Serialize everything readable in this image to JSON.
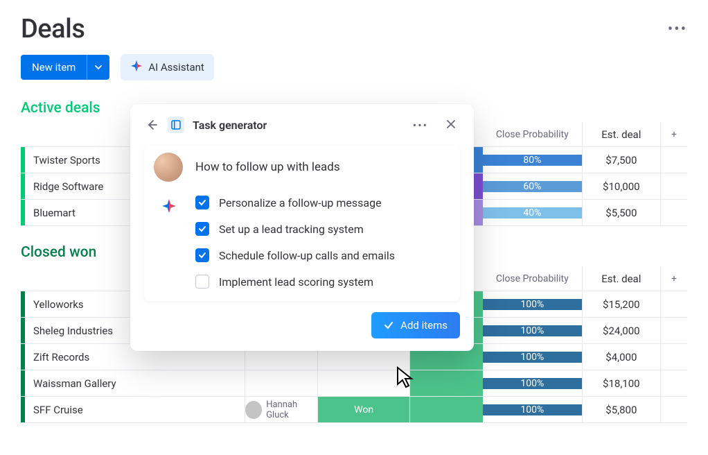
{
  "page": {
    "title": "Deals"
  },
  "toolbar": {
    "new_item": "New item",
    "ai_assistant": "AI Assistant"
  },
  "groups": {
    "active": {
      "title": "Active deals",
      "headers": {
        "prob": "Close Probability",
        "deal": "Est. deal"
      },
      "rows": [
        {
          "name": "Twister Sports",
          "accent": "#3b82d5",
          "prob_bg": "#3b82d5",
          "prob": "80%",
          "deal": "$7,500"
        },
        {
          "name": "Ridge Software",
          "accent": "#7b4ed0",
          "prob_bg": "#5b9cd8",
          "prob": "60%",
          "deal": "$10,000"
        },
        {
          "name": "Bluemart",
          "accent": "#a58ce0",
          "prob_bg": "#7fc0ea",
          "prob": "40%",
          "deal": "$5,500"
        }
      ]
    },
    "closed": {
      "title": "Closed won",
      "headers": {
        "prob": "Close Probability",
        "deal": "Est. deal"
      },
      "rows": [
        {
          "name": "Yelloworks",
          "accent": "#4cc38a",
          "prob_bg": "#2f6f9e",
          "prob": "100%",
          "deal": "$15,200"
        },
        {
          "name": "Sheleg Industries",
          "accent": "#4cc38a",
          "prob_bg": "#2f6f9e",
          "prob": "100%",
          "deal": "$24,000"
        },
        {
          "name": "Zift Records",
          "accent": "#4cc38a",
          "prob_bg": "#2f6f9e",
          "prob": "100%",
          "deal": "$4,000"
        },
        {
          "name": "Waissman Gallery",
          "accent": "#4cc38a",
          "prob_bg": "#2f6f9e",
          "prob": "100%",
          "deal": "$18,100"
        },
        {
          "name": "SFF Cruise",
          "accent": "#4cc38a",
          "prob_bg": "#2f6f9e",
          "prob": "100%",
          "deal": "$5,800",
          "status": "Won",
          "status_bg": "#4cc38a",
          "person": "Hannah Gluck"
        }
      ]
    }
  },
  "modal": {
    "title": "Task generator",
    "prompt": "How to follow up with leads",
    "tasks": [
      {
        "label": "Personalize a follow-up message",
        "checked": true
      },
      {
        "label": "Set up a lead tracking system",
        "checked": true
      },
      {
        "label": "Schedule follow-up calls and emails",
        "checked": true
      },
      {
        "label": "Implement lead scoring system",
        "checked": false
      }
    ],
    "add_items": "Add items"
  }
}
